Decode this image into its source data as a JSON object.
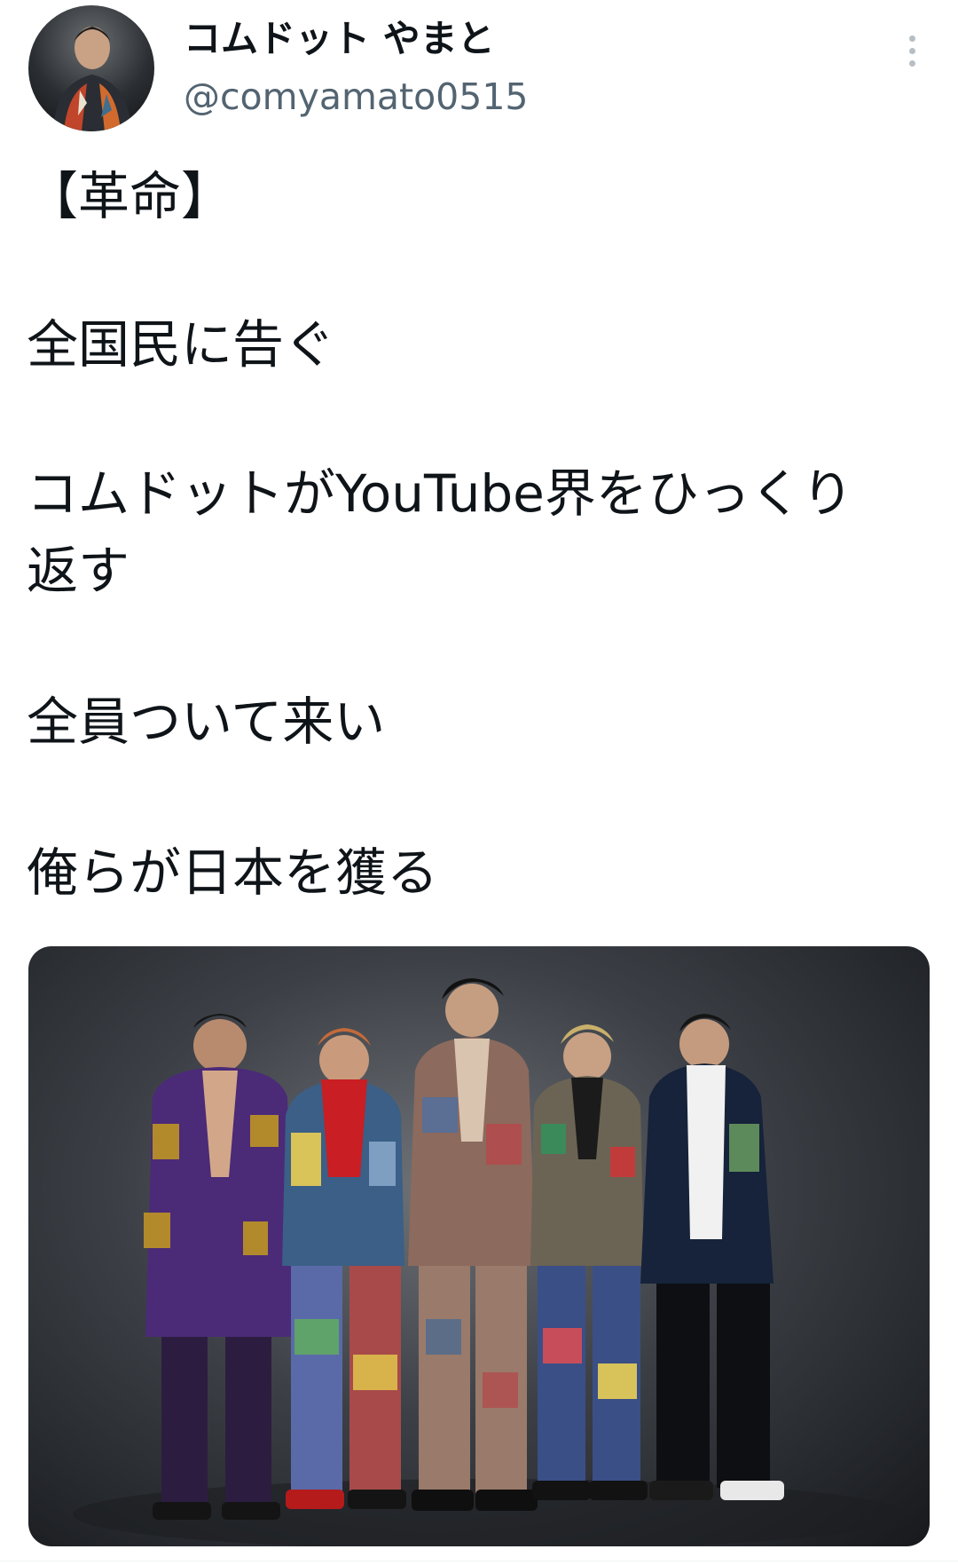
{
  "user": {
    "display_name": "コムドット やまと",
    "handle": "@comyamato0515",
    "avatar_icon": "profile-photo"
  },
  "more_icon": "more-vertical-icon",
  "tweet": {
    "lines": [
      "【革命】",
      "全国民に告ぐ",
      "コムドットがYouTube界をひっくり",
      "返す",
      "全員ついて来い",
      "俺らが日本を獲る"
    ]
  },
  "media": {
    "kind": "photo"
  },
  "colors": {
    "text": "#0f1419",
    "secondary": "#536471",
    "background": "#ffffff"
  }
}
